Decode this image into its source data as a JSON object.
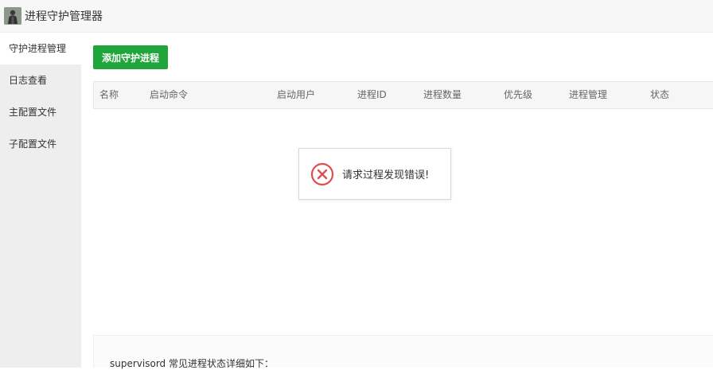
{
  "app": {
    "title": "进程守护管理器",
    "logo_icon": "app-avatar-icon"
  },
  "sidebar": {
    "items": [
      {
        "label": "守护进程管理",
        "active": true
      },
      {
        "label": "日志查看",
        "active": false
      },
      {
        "label": "主配置文件",
        "active": false
      },
      {
        "label": "子配置文件",
        "active": false
      }
    ]
  },
  "main": {
    "add_button_label": "添加守护进程",
    "table": {
      "columns": [
        "名称",
        "启动命令",
        "启动用户",
        "进程ID",
        "进程数量",
        "优先级",
        "进程管理",
        "状态"
      ],
      "rows": []
    },
    "toast": {
      "icon": "error-circle-icon",
      "message": "请求过程发现错误!"
    },
    "info_heading": "supervisord 常见进程状态详细如下："
  },
  "colors": {
    "accent_green": "#20a53a",
    "error_red": "#e0504b",
    "sidebar_bg": "#eeeeee",
    "header_bg": "#f6f6f6"
  }
}
